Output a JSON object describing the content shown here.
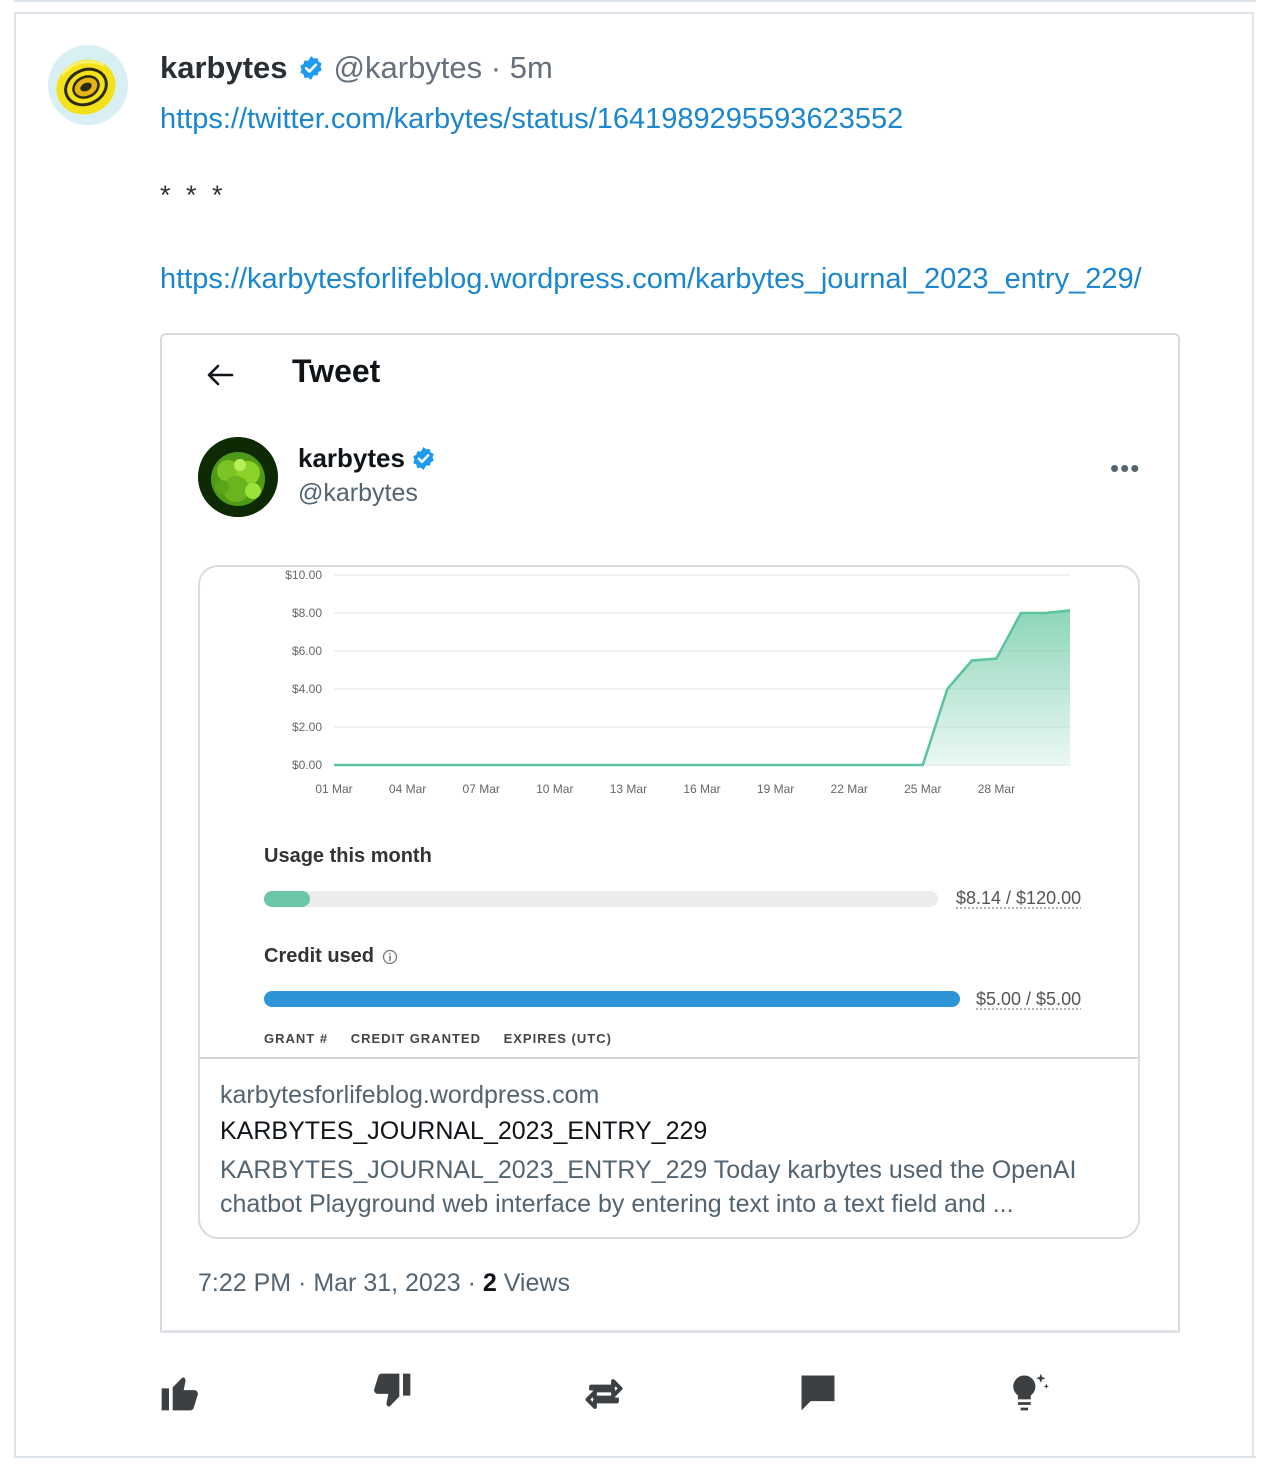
{
  "post": {
    "author_name": "karbytes",
    "author_handle": "@karbytes",
    "separator": "·",
    "time_ago": "5m",
    "link1": "https://twitter.com/karbytes/status/1641989295593623552",
    "stars": "* * *",
    "link2": "https://karbytesforlifeblog.wordpress.com/karbytes_journal_2023_entry_229/"
  },
  "embed": {
    "header_title": "Tweet",
    "author_name": "karbytes",
    "author_handle": "@karbytes",
    "more_label": "•••",
    "usage_label": "Usage this month",
    "usage_amount": "$8.14 / $120.00",
    "usage_fraction": 0.068,
    "credit_label": "Credit used",
    "credit_amount": "$5.00 / $5.00",
    "credit_fraction": 1.0,
    "table_columns": [
      "GRANT #",
      "CREDIT GRANTED",
      "EXPIRES (UTC)"
    ],
    "link_card": {
      "domain": "karbytesforlifeblog.wordpress.com",
      "title": "KARBYTES_JOURNAL_2023_ENTRY_229",
      "description": "KARBYTES_JOURNAL_2023_ENTRY_229 Today karbytes used the OpenAI chatbot Playground web interface by entering text into a text field and ..."
    },
    "meta_time": "7:22 PM · Mar 31, 2023 · ",
    "meta_views_count": "2",
    "meta_views_label": " Views"
  },
  "actions": {
    "like": "thumbs-up-icon",
    "dislike": "thumbs-down-icon",
    "repost": "repost-icon",
    "reply": "comment-icon",
    "insight": "lightbulb-icon"
  },
  "colors": {
    "link": "#1a86d0",
    "verified": "#1d9bf0",
    "usage_fill": "#6cc7a6",
    "credit_fill": "#2d95d6",
    "chart_line": "#5cc49c"
  },
  "chart_data": {
    "type": "area",
    "x_tick_labels": [
      "01 Mar",
      "04 Mar",
      "07 Mar",
      "10 Mar",
      "13 Mar",
      "16 Mar",
      "19 Mar",
      "22 Mar",
      "25 Mar",
      "28 Mar"
    ],
    "y_tick_labels": [
      "$10.00",
      "$8.00",
      "$6.00",
      "$4.00",
      "$2.00",
      "$0.00"
    ],
    "ylim": [
      0,
      10
    ],
    "grid": true,
    "series": [
      {
        "x": [
          1,
          2,
          3,
          4,
          5,
          6,
          7,
          8,
          9,
          10,
          11,
          12,
          13,
          14,
          15,
          16,
          17,
          18,
          19,
          20,
          21,
          22,
          23,
          24,
          25,
          26,
          27,
          28,
          29,
          30,
          31
        ],
        "values": [
          0,
          0,
          0,
          0,
          0,
          0,
          0,
          0,
          0,
          0,
          0,
          0,
          0,
          0,
          0,
          0,
          0,
          0,
          0,
          0,
          0,
          0,
          0,
          0,
          0,
          4.0,
          5.5,
          5.6,
          8.0,
          8.0,
          8.14
        ]
      }
    ]
  }
}
